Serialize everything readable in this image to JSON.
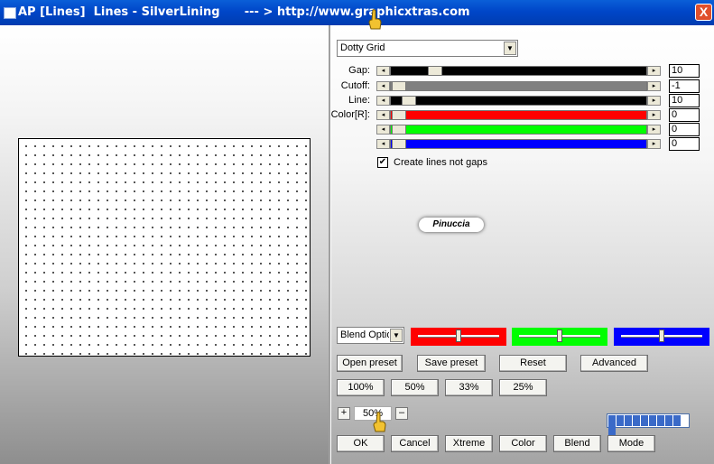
{
  "window": {
    "title": "AP [Lines]  Lines - SilverLining      --- > http://www.graphicxtras.com",
    "close": "X"
  },
  "preset_combo": {
    "value": "Dotty Grid"
  },
  "sliders": [
    {
      "label": "Gap:",
      "value": "10",
      "fill": "#000000",
      "level": 0.15
    },
    {
      "label": "Cutoff:",
      "value": "-1",
      "fill": "#808080",
      "level": 0.0
    },
    {
      "label": "Line:",
      "value": "10",
      "fill": "#000000",
      "level": 0.04
    },
    {
      "label": "Color[R]:",
      "value": "0",
      "fill": "#ff0000",
      "level": 0.0
    },
    {
      "label": "",
      "value": "0",
      "fill": "#00ff00",
      "level": 0.0
    },
    {
      "label": "",
      "value": "0",
      "fill": "#0000ff",
      "level": 0.0
    }
  ],
  "checkbox": {
    "label": "Create lines not gaps",
    "checked": true,
    "mark": "✔"
  },
  "logo": {
    "text": "Pinuccia"
  },
  "blend_combo": {
    "value": "Blend Optio"
  },
  "color_sliders": [
    {
      "color": "#ff0000",
      "level": 0.5
    },
    {
      "color": "#00ff00",
      "level": 0.5
    },
    {
      "color": "#0000ff",
      "level": 0.5
    }
  ],
  "buttons": {
    "open_preset": "Open preset",
    "save_preset": "Save preset",
    "reset": "Reset",
    "advanced": "Advanced",
    "z100": "100%",
    "z50": "50%",
    "z33": "33%",
    "z25": "25%",
    "ok": "OK",
    "cancel": "Cancel",
    "xtreme": "Xtreme",
    "color": "Color",
    "blend": "Blend",
    "mode": "Mode"
  },
  "zoom": {
    "plus": "+",
    "minus": "–",
    "value": "50%"
  },
  "progress": {
    "blocks": 10,
    "level": 1.0
  }
}
